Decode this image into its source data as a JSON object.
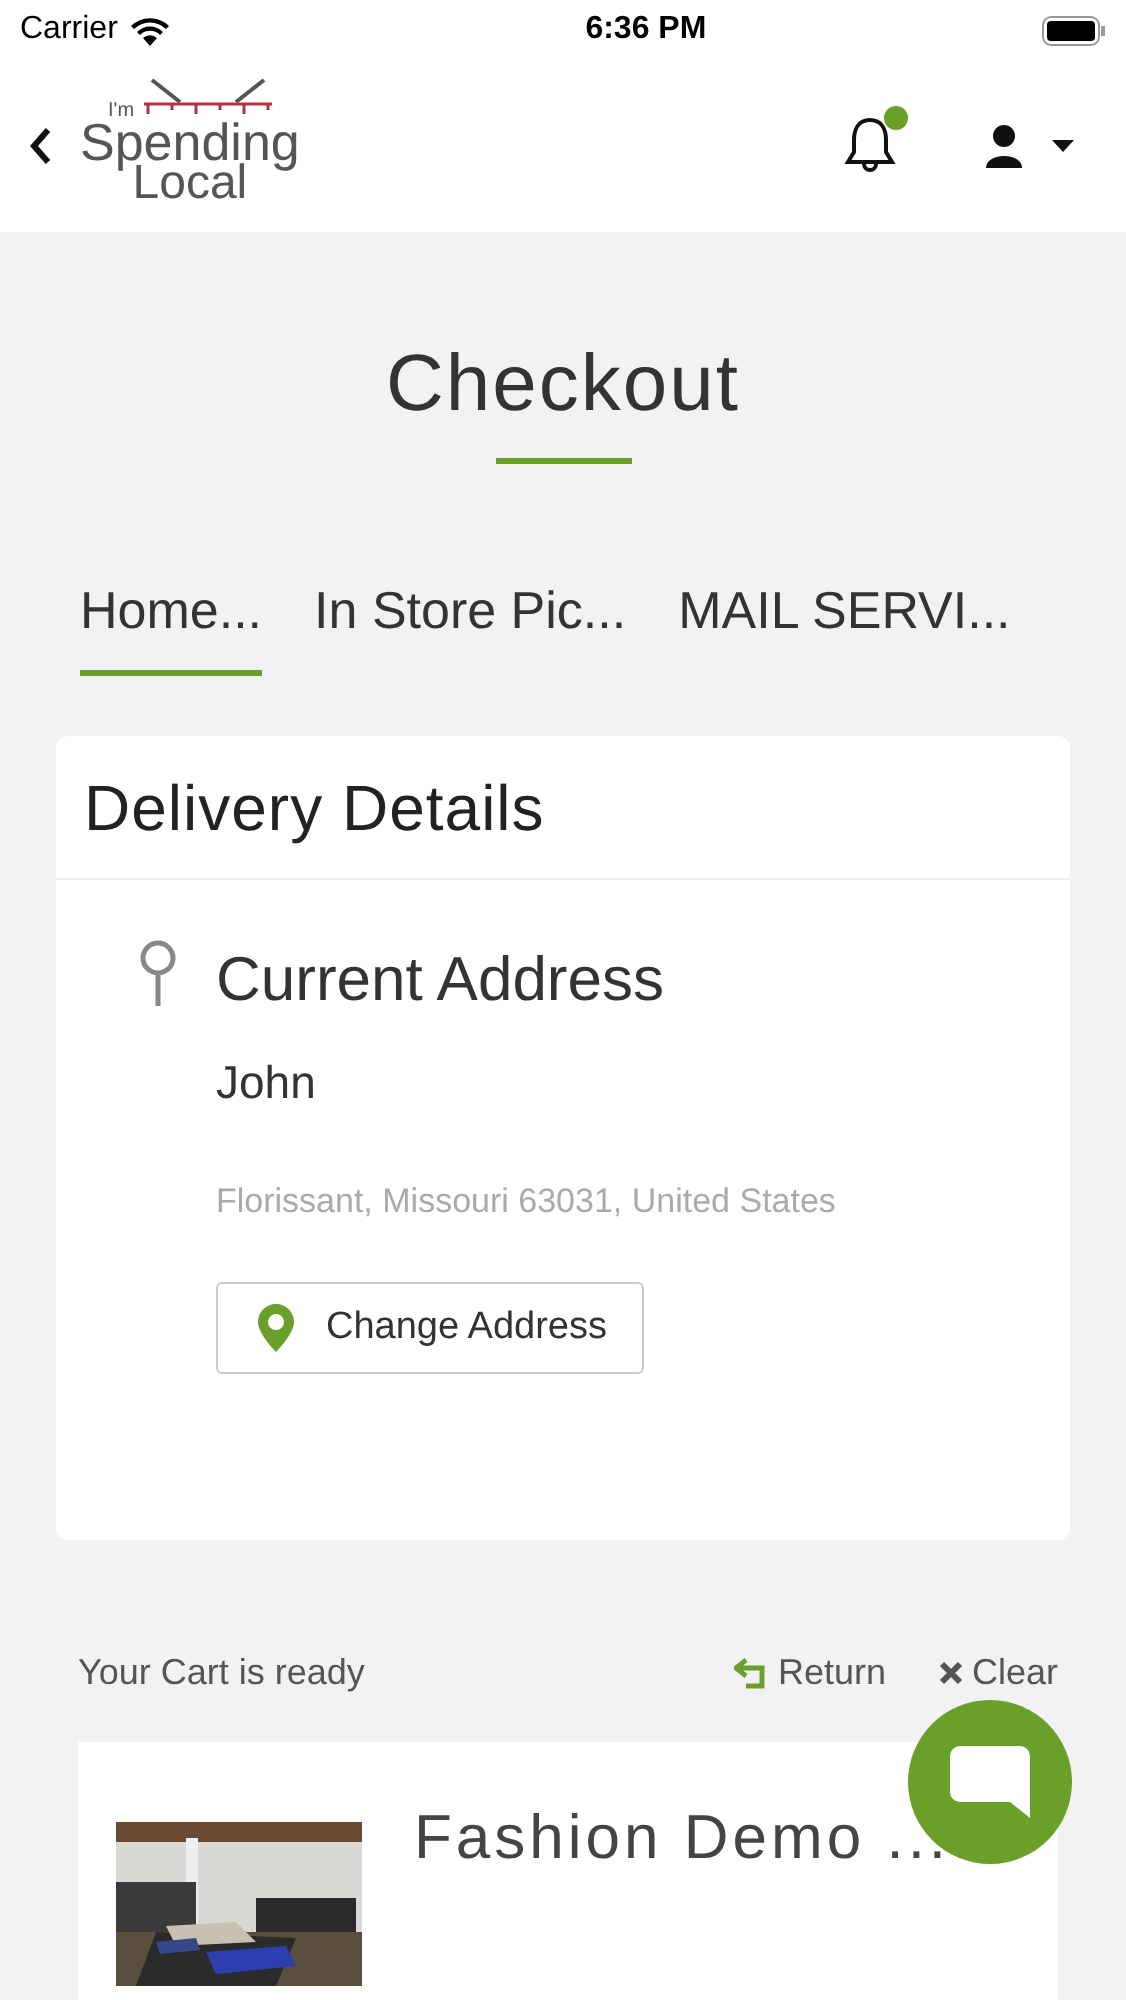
{
  "status_bar": {
    "carrier": "Carrier",
    "time": "6:36 PM"
  },
  "header": {
    "logo": {
      "small": "I'm",
      "line1": "Spending",
      "line2": "Local"
    },
    "notification_dot": true
  },
  "title": "Checkout",
  "tabs": [
    {
      "label": "Home...",
      "selected": true
    },
    {
      "label": "In Store Pic...",
      "selected": false
    },
    {
      "label": "MAIL SERVI...",
      "selected": false
    }
  ],
  "delivery": {
    "heading": "Delivery Details",
    "address_title": "Current Address",
    "name": "John",
    "address": "Florissant, Missouri 63031, United States",
    "button": "Change Address"
  },
  "cart": {
    "status": "Your Cart is ready",
    "return": "Return",
    "clear": "Clear",
    "store": "Fashion Demo ..."
  }
}
